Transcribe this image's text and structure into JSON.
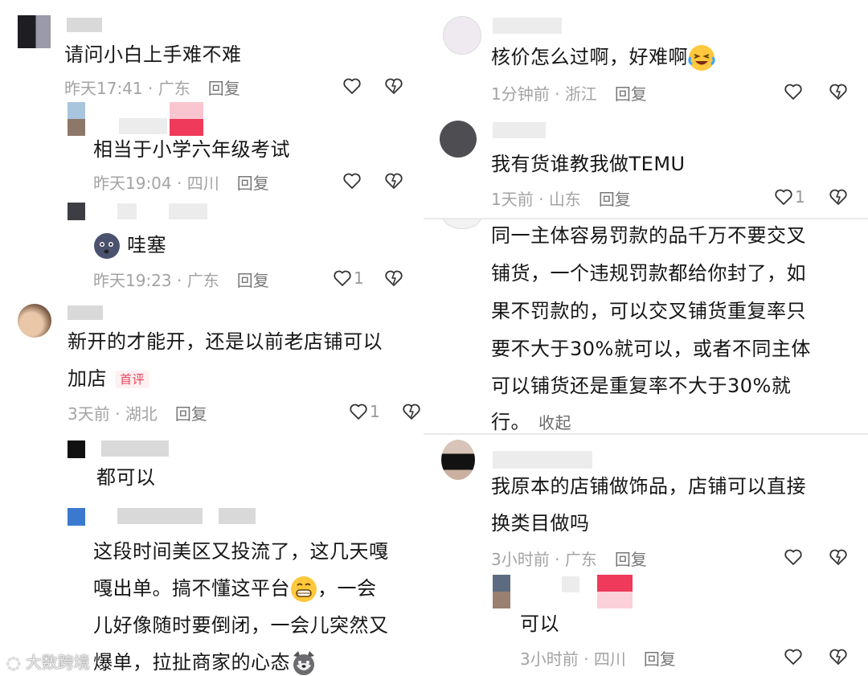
{
  "left": {
    "c1": {
      "text": "请问小白上手难不难",
      "time": "昨天17:41",
      "loc": "广东",
      "reply": "回复"
    },
    "c1r1": {
      "text": "相当于小学六年级考试",
      "time": "昨天19:04",
      "loc": "四川",
      "reply": "回复"
    },
    "c1r2": {
      "text": "哇塞",
      "time": "昨天19:23",
      "loc": "广东",
      "reply": "回复",
      "likes": "1"
    },
    "c2": {
      "line1": "新开的才能开，还是以前老店铺可以",
      "line2": "加店",
      "badge": "首评",
      "time": "3天前",
      "loc": "湖北",
      "reply": "回复",
      "likes": "1"
    },
    "c2r1": {
      "text": "都可以"
    },
    "c3": {
      "line1": "这段时间美区又投流了，这几天嘎",
      "line2": "嘎出单。搞不懂这平台",
      "line2b": "，一会",
      "line3": "儿好像随时要倒闭，一会儿突然又",
      "line4": "爆单，拉扯商家的心态"
    }
  },
  "right": {
    "c1": {
      "text": "核价怎么过啊，好难啊",
      "time": "1分钟前",
      "loc": "浙江",
      "reply": "回复"
    },
    "c2": {
      "text": "我有货谁教我做TEMU",
      "time": "1天前",
      "loc": "山东",
      "reply": "回复",
      "likes": "1"
    },
    "c3": {
      "line1": "同一主体容易罚款的品千万不要交叉",
      "line2": "铺货，一个违规罚款都给你封了，如",
      "line3": "果不罚款的，可以交叉铺货重复率只",
      "line4": "要不大于30%就可以，或者不同主体",
      "line5": "可以铺货还是重复率不大于30%就",
      "line6": "行。",
      "fold": "收起"
    },
    "c4": {
      "line1": "我原本的店铺做饰品，店铺可以直接",
      "line2": "换类目做吗",
      "time": "3小时前",
      "loc": "广东",
      "reply": "回复"
    },
    "c4r1": {
      "text": "可以",
      "time": "3小时前",
      "loc": "四川",
      "reply": "回复"
    }
  },
  "watermark": "大数跨境",
  "colors": {
    "accent_badge": "#e8435b",
    "meta": "#a3a3a3"
  },
  "icons": [
    "heart-icon",
    "dislike-icon",
    "emoji-laugh-cry",
    "emoji-grin",
    "emoji-dog"
  ]
}
